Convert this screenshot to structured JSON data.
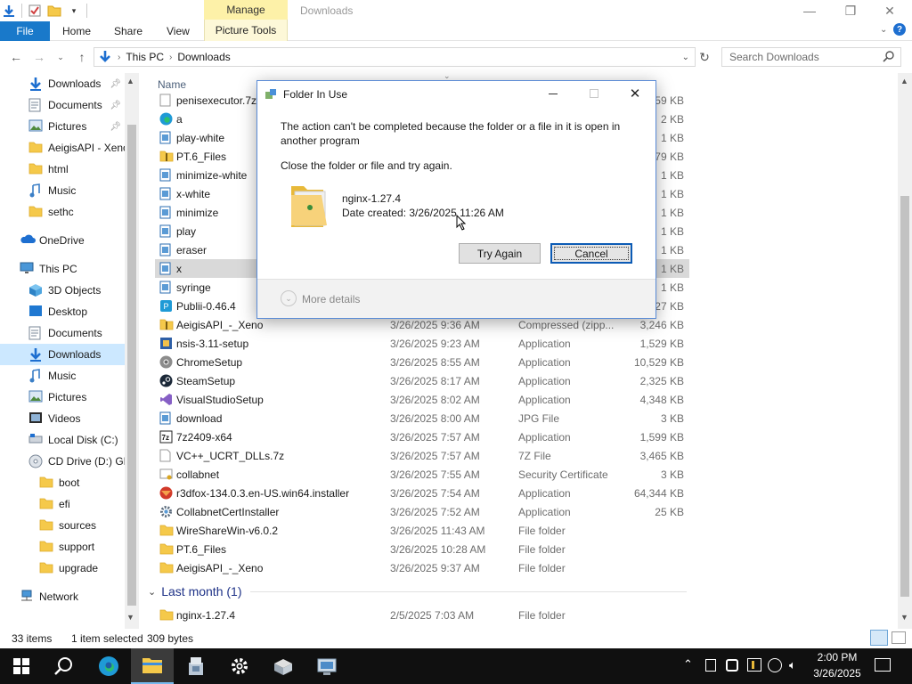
{
  "window": {
    "title": "Downloads",
    "manage_tab": "Manage",
    "picture_tools_tab": "Picture Tools",
    "minimize": "—",
    "maximize": "❐",
    "close": "✕"
  },
  "ribbon": {
    "tabs": [
      "File",
      "Home",
      "Share",
      "View"
    ]
  },
  "address": {
    "crumbs": [
      "This PC",
      "Downloads"
    ],
    "search_placeholder": "Search Downloads"
  },
  "nav": {
    "items": [
      {
        "label": "Downloads",
        "icon": "download-arrow-icon",
        "pinned": true
      },
      {
        "label": "Documents",
        "icon": "documents-icon",
        "pinned": true
      },
      {
        "label": "Pictures",
        "icon": "pictures-icon",
        "pinned": true
      },
      {
        "label": "AeigisAPI - Xeno",
        "icon": "folder-icon"
      },
      {
        "label": "html",
        "icon": "folder-icon"
      },
      {
        "label": "Music",
        "icon": "music-icon"
      },
      {
        "label": "sethc",
        "icon": "folder-icon"
      },
      {
        "label": "OneDrive",
        "icon": "onedrive-icon"
      },
      {
        "label": "This PC",
        "icon": "this-pc-icon"
      },
      {
        "label": "3D Objects",
        "icon": "3d-objects-icon"
      },
      {
        "label": "Desktop",
        "icon": "desktop-icon"
      },
      {
        "label": "Documents",
        "icon": "documents-icon"
      },
      {
        "label": "Downloads",
        "icon": "download-arrow-icon",
        "selected": true
      },
      {
        "label": "Music",
        "icon": "music-icon"
      },
      {
        "label": "Pictures",
        "icon": "pictures-icon"
      },
      {
        "label": "Videos",
        "icon": "videos-icon"
      },
      {
        "label": "Local Disk (C:)",
        "icon": "drive-icon"
      },
      {
        "label": "CD Drive (D:) GR",
        "icon": "cd-drive-icon"
      },
      {
        "label": "boot",
        "icon": "folder-icon"
      },
      {
        "label": "efi",
        "icon": "folder-icon"
      },
      {
        "label": "sources",
        "icon": "folder-icon"
      },
      {
        "label": "support",
        "icon": "folder-icon"
      },
      {
        "label": "upgrade",
        "icon": "folder-icon"
      },
      {
        "label": "Network",
        "icon": "network-icon"
      }
    ]
  },
  "files": {
    "column_name": "Name",
    "rows": [
      {
        "name": "penisexecutor.7z",
        "date": "",
        "type": "",
        "size": "959 KB",
        "icon": "archive-icon"
      },
      {
        "name": "a",
        "date": "",
        "type": "",
        "size": "2 KB",
        "icon": "edge-icon"
      },
      {
        "name": "play-white",
        "date": "",
        "type": "",
        "size": "1 KB",
        "icon": "image-file-icon"
      },
      {
        "name": "PT.6_Files",
        "date": "",
        "type": "",
        "size": "379 KB",
        "icon": "zip-folder-icon"
      },
      {
        "name": "minimize-white",
        "date": "",
        "type": "",
        "size": "1 KB",
        "icon": "image-file-icon"
      },
      {
        "name": "x-white",
        "date": "",
        "type": "",
        "size": "1 KB",
        "icon": "image-file-icon"
      },
      {
        "name": "minimize",
        "date": "",
        "type": "",
        "size": "1 KB",
        "icon": "image-file-icon"
      },
      {
        "name": "play",
        "date": "",
        "type": "",
        "size": "1 KB",
        "icon": "image-file-icon"
      },
      {
        "name": "eraser",
        "date": "",
        "type": "",
        "size": "1 KB",
        "icon": "image-file-icon"
      },
      {
        "name": "x",
        "date": "",
        "type": "",
        "size": "1 KB",
        "icon": "image-file-icon",
        "selected": true
      },
      {
        "name": "syringe",
        "date": "",
        "type": "",
        "size": "1 KB",
        "icon": "image-file-icon"
      },
      {
        "name": "Publii-0.46.4",
        "date": "",
        "type": "",
        "size": "527 KB",
        "icon": "publii-icon"
      },
      {
        "name": "AeigisAPI_-_Xeno",
        "date": "3/26/2025 9:36 AM",
        "type": "Compressed (zipp...",
        "size": "3,246 KB",
        "icon": "zip-folder-icon"
      },
      {
        "name": "nsis-3.11-setup",
        "date": "3/26/2025 9:23 AM",
        "type": "Application",
        "size": "1,529 KB",
        "icon": "installer-icon"
      },
      {
        "name": "ChromeSetup",
        "date": "3/26/2025 8:55 AM",
        "type": "Application",
        "size": "10,529 KB",
        "icon": "chrome-icon"
      },
      {
        "name": "SteamSetup",
        "date": "3/26/2025 8:17 AM",
        "type": "Application",
        "size": "2,325 KB",
        "icon": "steam-icon"
      },
      {
        "name": "VisualStudioSetup",
        "date": "3/26/2025 8:02 AM",
        "type": "Application",
        "size": "4,348 KB",
        "icon": "visual-studio-icon"
      },
      {
        "name": "download",
        "date": "3/26/2025 8:00 AM",
        "type": "JPG File",
        "size": "3 KB",
        "icon": "image-file-icon"
      },
      {
        "name": "7z2409-x64",
        "date": "3/26/2025 7:57 AM",
        "type": "Application",
        "size": "1,599 KB",
        "icon": "7zip-icon"
      },
      {
        "name": "VC++_UCRT_DLLs.7z",
        "date": "3/26/2025 7:57 AM",
        "type": "7Z File",
        "size": "3,465 KB",
        "icon": "blank-file-icon"
      },
      {
        "name": "collabnet",
        "date": "3/26/2025 7:55 AM",
        "type": "Security Certificate",
        "size": "3 KB",
        "icon": "certificate-icon"
      },
      {
        "name": "r3dfox-134.0.3.en-US.win64.installer",
        "date": "3/26/2025 7:54 AM",
        "type": "Application",
        "size": "64,344 KB",
        "icon": "r3dfox-icon"
      },
      {
        "name": "CollabnetCertInstaller",
        "date": "3/26/2025 7:52 AM",
        "type": "Application",
        "size": "25 KB",
        "icon": "gear-app-icon"
      },
      {
        "name": "WireShareWin-v6.0.2",
        "date": "3/26/2025 11:43 AM",
        "type": "File folder",
        "size": "",
        "icon": "folder-icon"
      },
      {
        "name": "PT.6_Files",
        "date": "3/26/2025 10:28 AM",
        "type": "File folder",
        "size": "",
        "icon": "folder-icon"
      },
      {
        "name": "AeigisAPI_-_Xeno",
        "date": "3/26/2025 9:37 AM",
        "type": "File folder",
        "size": "",
        "icon": "folder-icon"
      }
    ],
    "group_last_month": "Last month (1)",
    "last_month_rows": [
      {
        "name": "nginx-1.27.4",
        "date": "2/5/2025 7:03 AM",
        "type": "File folder",
        "size": "",
        "icon": "folder-icon"
      }
    ]
  },
  "status": {
    "count": "33 items",
    "selected": "1 item selected",
    "size": "309 bytes"
  },
  "dialog": {
    "title": "Folder In Use",
    "message": "The action can't be completed because the folder or a file in it is open in another program",
    "instruction": "Close the folder or file and try again.",
    "item_name": "nginx-1.27.4",
    "item_date": "Date created: 3/26/2025 11:26 AM",
    "try_again": "Try Again",
    "cancel": "Cancel",
    "more_details": "More details"
  },
  "taskbar": {
    "time": "2:00 PM",
    "date": "3/26/2025"
  }
}
